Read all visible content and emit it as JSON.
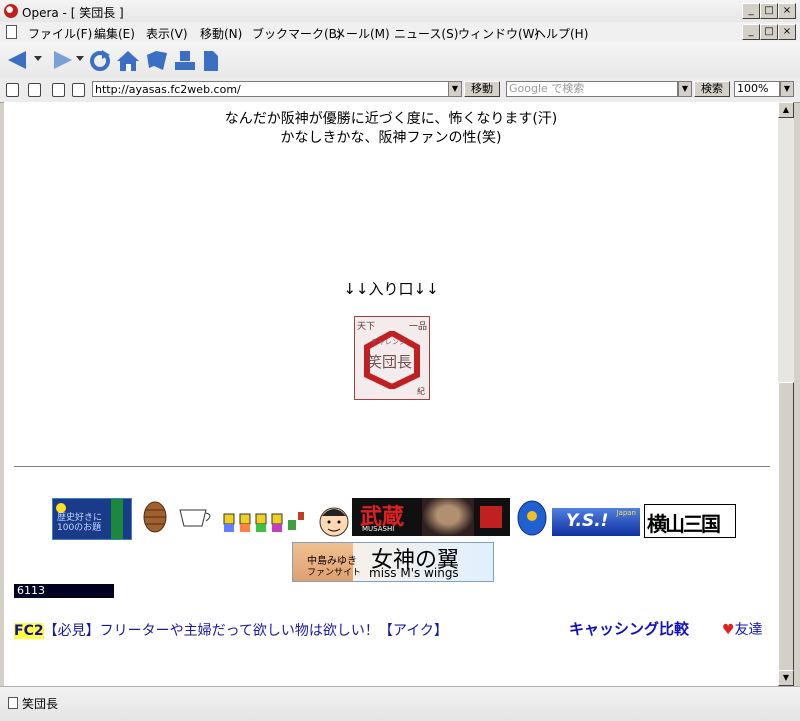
{
  "window": {
    "title": "Opera - [ 笑団長 ]",
    "min": "_",
    "max": "□",
    "close": "×"
  },
  "menu": [
    "ファイル(F)",
    "編集(E)",
    "表示(V)",
    "移動(N)",
    "ブックマーク(B)",
    "メール(M)",
    "ニュース(S)",
    "ウィンドウ(W)",
    "ヘルプ(H)"
  ],
  "address": {
    "url": "http://ayasas.fc2web.com/",
    "go_label": "移動",
    "search_placeholder": "Google で検索",
    "search_label": "検索",
    "zoom": "100%"
  },
  "page": {
    "line1": "なんだか阪神が優勝に近づく度に、怖くなります(汗)",
    "line2": "かなしきかな、阪神ファンの性(笑)",
    "entrance": "↓↓入り口↓↓",
    "stamp": {
      "top_left": "天下",
      "top_right": "一品",
      "mid": "チャレンジ",
      "center": "笑団長",
      "bottom": "紀"
    },
    "banners": {
      "history": "歴史好きに100のお題",
      "musashi_big": "武蔵",
      "musashi_small": "MUSASHI",
      "yeos": "Y.S.!",
      "yeos_sub": "Japan",
      "sangokushi": "横山三国志",
      "miyuki_name": "中島みゆき",
      "miyuki_site": "ファンサイト",
      "miyuki_title": "女神の翼",
      "miyuki_en": "miss M's wings"
    },
    "counter": "6113",
    "fc2_tag": "FC2",
    "fc2_text": "【必見】フリーターや主婦だって欲しい物は欲しい！【アイク】",
    "cashing": "キャッシング比較",
    "friend": "友達"
  },
  "status": {
    "text": "笑団長"
  },
  "colors": {
    "nav_blue": "#3b6fc4",
    "stamp_red": "#c02020",
    "link_blue": "#1010c0"
  }
}
